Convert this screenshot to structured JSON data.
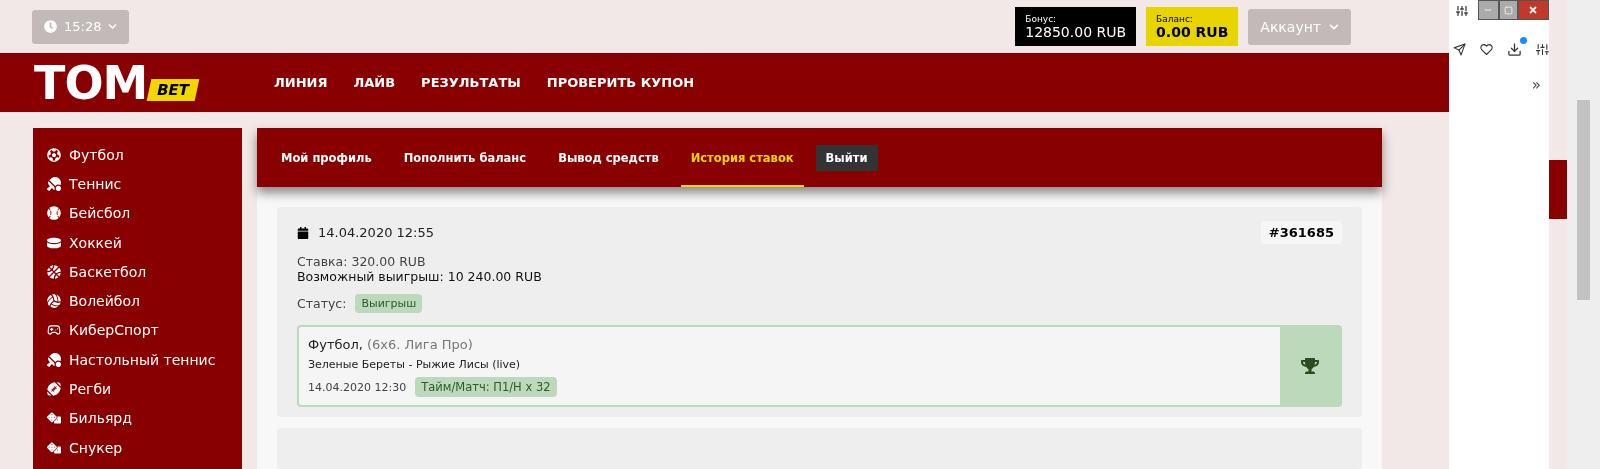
{
  "topbar": {
    "time": "15:28",
    "bonus": {
      "label": "Бонус:",
      "value": "12850.00 RUB"
    },
    "balance": {
      "label": "Баланс:",
      "value": "0.00 RUB"
    },
    "account": "Аккаунт"
  },
  "logo": {
    "main": "TOM",
    "badge": "BET"
  },
  "nav": [
    "ЛИНИЯ",
    "ЛАЙВ",
    "РЕЗУЛЬТАТЫ",
    "ПРОВЕРИТЬ КУПОН"
  ],
  "sidebar": {
    "items": [
      "Футбол",
      "Теннис",
      "Бейсбол",
      "Хоккей",
      "Баскетбол",
      "Волейбол",
      "КиберСпорт",
      "Настольный теннис",
      "Регби",
      "Бильярд",
      "Снукер"
    ]
  },
  "tabs": [
    {
      "label": "Мой профиль",
      "selected": false,
      "kind": "link"
    },
    {
      "label": "Пополнить баланс",
      "selected": false,
      "kind": "link"
    },
    {
      "label": "Вывод средств",
      "selected": false,
      "kind": "link"
    },
    {
      "label": "История ставок",
      "selected": true,
      "kind": "link"
    },
    {
      "label": "Выйти",
      "selected": false,
      "kind": "button"
    }
  ],
  "bet": {
    "date": "14.04.2020 12:55",
    "id": "#361685",
    "stake": "Ставка: 320.00 RUB",
    "payout": "Возможный выигрыш: 10 240.00 RUB",
    "status_label": "Статус:",
    "status": "Выигрыш",
    "event": {
      "sport": "Футбол,",
      "league": "(6x6. Лига Про)",
      "match": "Зеленые Береты - Рыжие Лисы (live)",
      "time": "14.04.2020 12:30",
      "pick": "Тайм/Матч: П1/Н x 32",
      "won": true
    }
  },
  "browser": {
    "more": "»"
  }
}
